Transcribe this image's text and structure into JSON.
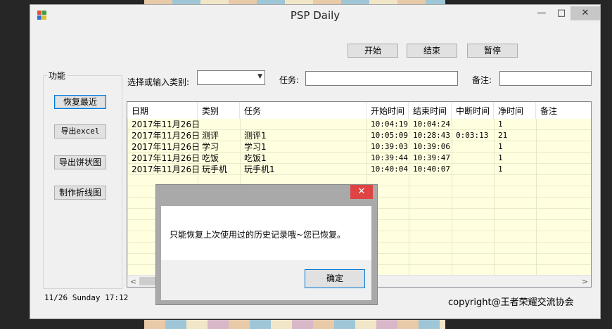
{
  "window": {
    "title": "PSP Daily",
    "minimize": "—",
    "maximize": "□",
    "close": "✕"
  },
  "toolbar": {
    "start": "开始",
    "end": "结束",
    "pause": "暂停"
  },
  "functions": {
    "group_label": "功能",
    "restore_recent": "恢复最近",
    "export_excel": "导出excel",
    "export_pie": "导出饼状图",
    "make_line": "制作折线图"
  },
  "form": {
    "category_label": "选择或输入类别:",
    "category_value": "",
    "task_label": "任务:",
    "task_value": "",
    "note_label": "备注:",
    "note_value": ""
  },
  "table": {
    "columns": [
      "日期",
      "类别",
      "任务",
      "开始时间",
      "结束时间",
      "中断时间",
      "净时间",
      "备注"
    ],
    "rows": [
      [
        "2017年11月26日",
        "",
        "",
        "10:04:19",
        "10:04:24",
        "",
        "1",
        ""
      ],
      [
        "2017年11月26日",
        "测评",
        "测评1",
        "10:05:09",
        "10:28:43",
        "0:03:13",
        "21",
        ""
      ],
      [
        "2017年11月26日",
        "学习",
        "学习1",
        "10:39:03",
        "10:39:06",
        "",
        "1",
        ""
      ],
      [
        "2017年11月26日",
        "吃饭",
        "吃饭1",
        "10:39:44",
        "10:39:47",
        "",
        "1",
        ""
      ],
      [
        "2017年11月26日",
        "玩手机",
        "玩手机1",
        "10:40:04",
        "10:40:07",
        "",
        "1",
        ""
      ]
    ]
  },
  "scroll": {
    "left_arrow": "<",
    "right_arrow": ">"
  },
  "status": {
    "datetime": "11/26  Sunday 17:12"
  },
  "footer": {
    "copyright": "copyright@王者荣耀交流协会"
  },
  "dialog": {
    "message": "只能恢复上次使用过的历史记录哦~您已恢复。",
    "ok": "确定",
    "close": "✕"
  },
  "colors": {
    "grid_bg": "#ffffe0",
    "accent": "#0078d7",
    "close_red": "#e04343"
  }
}
